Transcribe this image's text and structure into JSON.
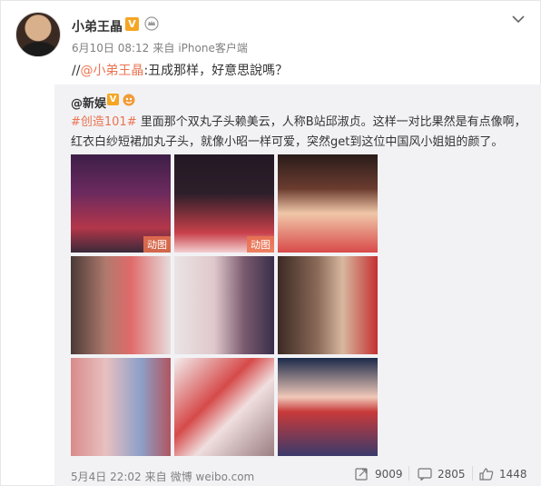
{
  "post": {
    "username": "小弟王晶",
    "vip_label": "V",
    "meta": {
      "date": "6月10日 08:12",
      "via": "来自",
      "client": "iPhone客户端"
    },
    "repost": {
      "prefix": "//",
      "mention": "@小弟王晶",
      "text": ":丑成那样，好意思說嗎？"
    }
  },
  "quoted": {
    "author": "@新娱",
    "vip_label": "V",
    "hashtag": "#创造101#",
    "body": " 里面那个双丸子头赖美云，人称B站邱淑贞。这样一对比果然是有点像啊，红衣白纱短裙加丸子头，就像小昭一样可爱，突然get到这位中国风小姐姐的颜了。",
    "images": [
      {
        "gif_label": "动图"
      },
      {
        "gif_label": "动图"
      },
      {
        "gif_label": ""
      },
      {
        "gif_label": ""
      },
      {
        "gif_label": ""
      },
      {
        "gif_label": ""
      },
      {
        "gif_label": ""
      },
      {
        "gif_label": ""
      },
      {
        "gif_label": ""
      }
    ],
    "footer": {
      "date": "5月4日 22:02",
      "via": "来自",
      "client": "微博 weibo.com",
      "reposts": "9009",
      "comments": "2805",
      "likes": "1448"
    }
  },
  "colors": {
    "accent": "#eb7350",
    "vip": "#f5a623",
    "quote_bg": "#f2f2f5",
    "meta_text": "#808080"
  }
}
